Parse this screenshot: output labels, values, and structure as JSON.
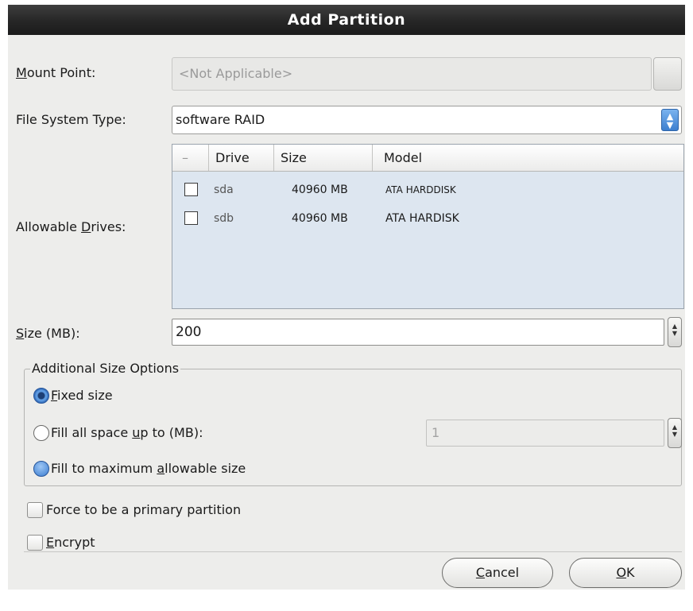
{
  "dialog": {
    "title": "Add Partition"
  },
  "mount_point": {
    "label_prefix": "",
    "label_mnemonic": "M",
    "label_rest": "ount Point:",
    "value": "<Not Applicable>"
  },
  "fs_type": {
    "label": "File System Type:",
    "value": "software RAID"
  },
  "drives": {
    "label_prefix": "Allowable ",
    "label_mnemonic": "D",
    "label_rest": "rives:",
    "columns": [
      "–",
      "Drive",
      "Size",
      "Model"
    ],
    "rows": [
      {
        "drive": "sda",
        "size": "40960 MB",
        "model": "ATA HARDDISK",
        "checked": false
      },
      {
        "drive": "sdb",
        "size": "40960 MB",
        "model": "ATA HARDISK",
        "checked": false
      }
    ]
  },
  "size": {
    "label_mnemonic": "S",
    "label_rest": "ize (MB):",
    "value": "200"
  },
  "size_options": {
    "title": "Additional Size Options",
    "fixed": {
      "mnemonic": "F",
      "rest": "ixed size",
      "selected": true
    },
    "fill_upto": {
      "prefix": "Fill all space ",
      "mnemonic": "u",
      "rest": "p to (MB):",
      "selected": false,
      "value": "1"
    },
    "fill_max": {
      "prefix": "Fill to maximum ",
      "mnemonic": "a",
      "rest": "llowable size",
      "selected": false
    }
  },
  "primary": {
    "label": "Force to be a primary partition",
    "checked": false
  },
  "encrypt": {
    "mnemonic": "E",
    "rest": "ncrypt",
    "checked": false
  },
  "buttons": {
    "cancel": {
      "mnemonic": "C",
      "rest": "ancel"
    },
    "ok": {
      "mnemonic": "O",
      "rest": "K"
    }
  },
  "colors": {
    "titlebar": "#262626",
    "window_bg": "#ededeb",
    "drives_bg": "#dde6f0",
    "accent": "#3d7fcf"
  }
}
